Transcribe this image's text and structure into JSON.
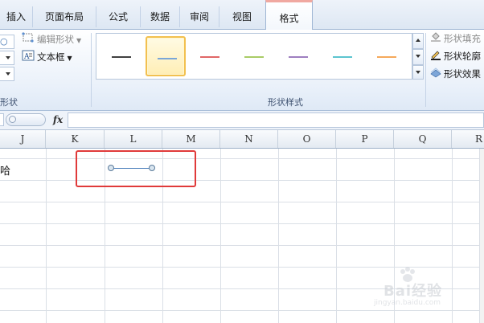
{
  "ribbon_tabs": [
    {
      "label": "插入",
      "active": false
    },
    {
      "label": "页面布局",
      "active": false
    },
    {
      "label": "公式",
      "active": false
    },
    {
      "label": "数据",
      "active": false
    },
    {
      "label": "审阅",
      "active": false
    },
    {
      "label": "视图",
      "active": false
    },
    {
      "label": "格式",
      "active": true
    }
  ],
  "insert_shapes_group": {
    "edit_shape_label": "编辑形状",
    "text_box_label": "文本框",
    "group_label_fragment": "形状"
  },
  "shape_styles_group": {
    "group_label": "形状样式",
    "swatch_colors": [
      "#404040",
      "#7aa7d8",
      "#e06666",
      "#a9cc66",
      "#9e7fc0",
      "#5cc4cf",
      "#f5a95b"
    ],
    "selected_index": 1,
    "fill_label": "形状填充",
    "outline_label": "形状轮廓",
    "effects_label": "形状效果"
  },
  "formula_bar": {
    "fx_label": "fx",
    "value": ""
  },
  "columns": [
    "J",
    "K",
    "L",
    "M",
    "N",
    "O",
    "P",
    "Q",
    "R"
  ],
  "cells": {
    "J_row1_fragment": "哈"
  },
  "watermark": {
    "brand": "Bai经验",
    "url": "jingyan.baidu.com"
  }
}
